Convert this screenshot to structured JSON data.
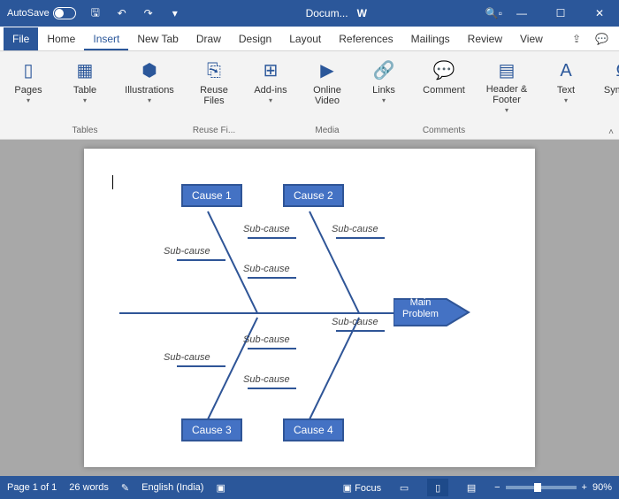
{
  "titlebar": {
    "autosave": "AutoSave",
    "docname": "Docum...",
    "wordicon": "W"
  },
  "tabs": {
    "file": "File",
    "home": "Home",
    "insert": "Insert",
    "newtab": "New Tab",
    "draw": "Draw",
    "design": "Design",
    "layout": "Layout",
    "references": "References",
    "mailings": "Mailings",
    "review": "Review",
    "view": "View"
  },
  "ribbon": {
    "pages": "Pages",
    "table": "Table",
    "tables_group": "Tables",
    "illustrations": "Illustrations",
    "reuse": "Reuse Files",
    "reuse_group": "Reuse Fi...",
    "addins": "Add-ins",
    "video": "Online Video",
    "media_group": "Media",
    "links": "Links",
    "comment": "Comment",
    "comments_group": "Comments",
    "header": "Header & Footer",
    "text": "Text",
    "symbols": "Symbols"
  },
  "diagram": {
    "cause1": "Cause 1",
    "cause2": "Cause 2",
    "cause3": "Cause 3",
    "cause4": "Cause 4",
    "main1": "Main",
    "main2": "Problem",
    "sub": "Sub-cause"
  },
  "status": {
    "page": "Page 1 of 1",
    "words": "26 words",
    "lang": "English (India)",
    "focus": "Focus",
    "zoom": "90%"
  }
}
